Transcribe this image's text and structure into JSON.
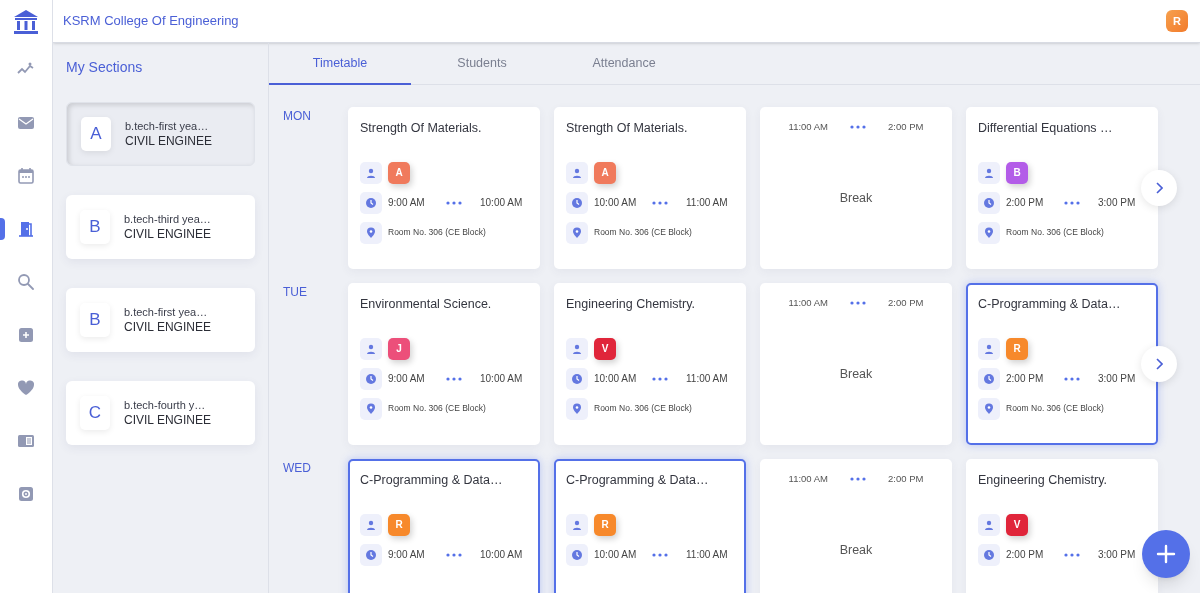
{
  "header": {
    "title": "KSRM College Of Engineering",
    "avatar": "R"
  },
  "nav": [
    {
      "kind": "trend",
      "selected": false
    },
    {
      "kind": "mail",
      "selected": false
    },
    {
      "kind": "calendar",
      "selected": false
    },
    {
      "kind": "door",
      "selected": true
    },
    {
      "kind": "search",
      "selected": false
    },
    {
      "kind": "plusbox",
      "selected": false
    },
    {
      "kind": "heart",
      "selected": false
    },
    {
      "kind": "book",
      "selected": false
    },
    {
      "kind": "settings",
      "selected": false
    }
  ],
  "sections_title": "My Sections",
  "sections": [
    {
      "letter": "A",
      "year": "b.tech-first yea…",
      "dept": "CIVIL ENGINEE",
      "selected": true
    },
    {
      "letter": "B",
      "year": "b.tech-third yea…",
      "dept": "CIVIL ENGINEE",
      "selected": false
    },
    {
      "letter": "B",
      "year": "b.tech-first yea…",
      "dept": "CIVIL ENGINEE",
      "selected": false
    },
    {
      "letter": "C",
      "year": "b.tech-fourth y…",
      "dept": "CIVIL ENGINEE",
      "selected": false
    }
  ],
  "tabs": [
    {
      "label": "Timetable",
      "selected": true
    },
    {
      "label": "Students",
      "selected": false
    },
    {
      "label": "Attendance",
      "selected": false
    }
  ],
  "days": [
    {
      "day": "MON",
      "has_next": true,
      "slots": [
        {
          "kind": "class",
          "title": "Strength Of Materials.",
          "teacher": "A",
          "color": "#f07a5c",
          "start": "9:00 AM",
          "end": "10:00 AM",
          "room": "Room No. 306 (CE Block)",
          "selected": false
        },
        {
          "kind": "class",
          "title": "Strength Of Materials.",
          "teacher": "A",
          "color": "#f07a5c",
          "start": "10:00 AM",
          "end": "11:00 AM",
          "room": "Room No. 306 (CE Block)",
          "selected": false
        },
        {
          "kind": "break",
          "title": "Break",
          "start": "11:00 AM",
          "end": "2:00 PM"
        },
        {
          "kind": "class",
          "title": "Differential Equations …",
          "teacher": "B",
          "color": "#b35ce8",
          "start": "2:00 PM",
          "end": "3:00 PM",
          "room": "Room No. 306 (CE Block)",
          "selected": false
        }
      ]
    },
    {
      "day": "TUE",
      "has_next": true,
      "slots": [
        {
          "kind": "class",
          "title": "Environmental Science.",
          "teacher": "J",
          "color": "#ec4f7a",
          "start": "9:00 AM",
          "end": "10:00 AM",
          "room": "Room No. 306 (CE Block)",
          "selected": false
        },
        {
          "kind": "class",
          "title": "Engineering Chemistry.",
          "teacher": "V",
          "color": "#e0253a",
          "start": "10:00 AM",
          "end": "11:00 AM",
          "room": "Room No. 306 (CE Block)",
          "selected": false
        },
        {
          "kind": "break",
          "title": "Break",
          "start": "11:00 AM",
          "end": "2:00 PM"
        },
        {
          "kind": "class",
          "title": "C-Programming & Data…",
          "teacher": "R",
          "color": "#f7892b",
          "start": "2:00 PM",
          "end": "3:00 PM",
          "room": "Room No. 306 (CE Block)",
          "selected": true
        }
      ]
    },
    {
      "day": "WED",
      "has_next": false,
      "slots": [
        {
          "kind": "class",
          "title": "C-Programming & Data…",
          "teacher": "R",
          "color": "#f7892b",
          "start": "9:00 AM",
          "end": "10:00 AM",
          "selected": true
        },
        {
          "kind": "class",
          "title": "C-Programming & Data…",
          "teacher": "R",
          "color": "#f7892b",
          "start": "10:00 AM",
          "end": "11:00 AM",
          "selected": true
        },
        {
          "kind": "break",
          "title": "Break",
          "start": "11:00 AM",
          "end": "2:00 PM"
        },
        {
          "kind": "class",
          "title": "Engineering Chemistry.",
          "teacher": "V",
          "color": "#e0253a",
          "start": "2:00 PM",
          "end": "3:00 PM",
          "selected": false
        }
      ]
    }
  ]
}
